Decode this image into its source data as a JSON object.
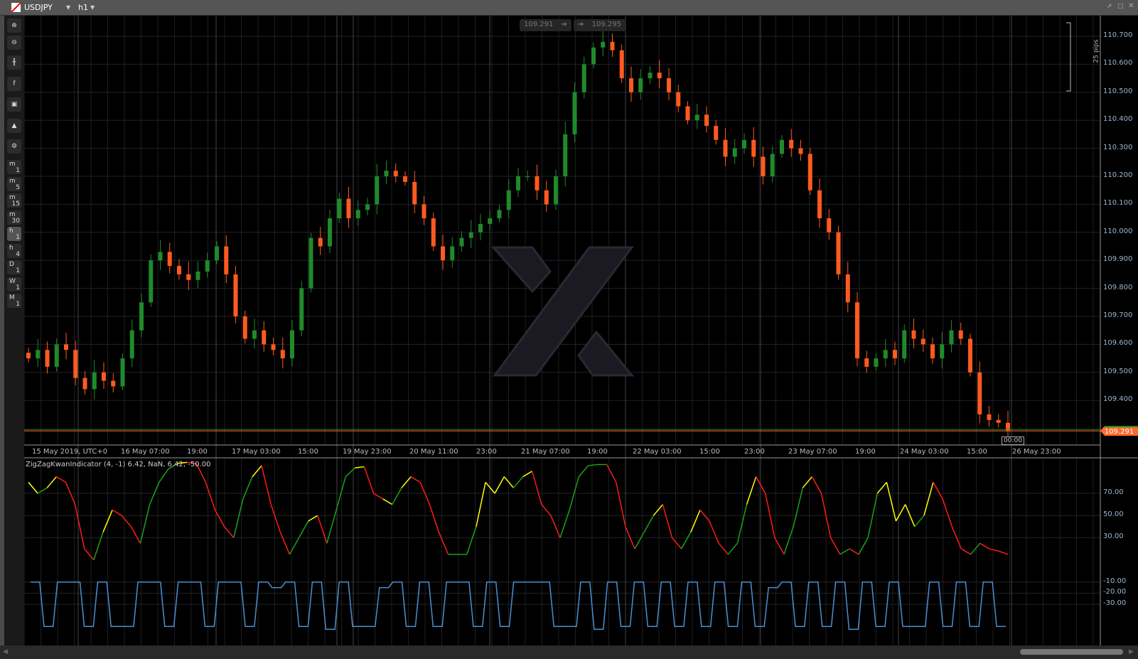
{
  "window": {
    "symbol": "USDJPY",
    "timeframe": "h1"
  },
  "toolbar": {
    "timeframes": [
      [
        "m",
        "1"
      ],
      [
        "m",
        "5"
      ],
      [
        "m",
        "15"
      ],
      [
        "m",
        "30"
      ],
      [
        "h",
        "1"
      ],
      [
        "h",
        "4"
      ],
      [
        "D",
        "1"
      ],
      [
        "W",
        "1"
      ],
      [
        "M",
        "1"
      ]
    ],
    "active": "h1"
  },
  "quick_trade": {
    "sell": "109.291",
    "buy": "109.295"
  },
  "price_axis": [
    "110.700",
    "110.600",
    "110.500",
    "110.400",
    "110.300",
    "110.200",
    "110.100",
    "110.000",
    "109.900",
    "109.800",
    "109.700",
    "109.600",
    "109.500",
    "109.400"
  ],
  "pips_ruler": "25 pips",
  "current_price": "109.291",
  "countdown": "00:00",
  "time_axis": [
    "15 May 2019, UTC+0",
    "16 May 07:00",
    "19:00",
    "17 May 03:00",
    "15:00",
    "19 May 23:00",
    "20 May 11:00",
    "23:00",
    "21 May 07:00",
    "19:00",
    "22 May 03:00",
    "15:00",
    "23:00",
    "23 May 07:00",
    "19:00",
    "24 May 03:00",
    "15:00",
    "26 May 23:00"
  ],
  "indicator": {
    "label": "ZigZagKwanIndicator (4, -1) 6.42, NaN, 6.42, -50.00",
    "axis": [
      "70.00",
      "50.00",
      "30.00",
      "-10.00",
      "-20.00",
      "-30.00"
    ]
  },
  "colors": {
    "bull": "#1f8a2a",
    "bear": "#ff5a1f",
    "up": "#1aa31a",
    "down": "#ff1a1a",
    "turn": "#ffff00",
    "signal": "#4a8fd0",
    "price_line": "#ff6a2a"
  },
  "chart_data": {
    "type": "candlestick",
    "wick": 0.03,
    "closes": [
      109.55,
      109.58,
      109.52,
      109.6,
      109.58,
      109.48,
      109.44,
      109.5,
      109.47,
      109.45,
      109.55,
      109.65,
      109.75,
      109.9,
      109.93,
      109.88,
      109.85,
      109.83,
      109.86,
      109.9,
      109.95,
      109.85,
      109.7,
      109.62,
      109.65,
      109.6,
      109.58,
      109.55,
      109.65,
      109.8,
      109.98,
      109.95,
      110.05,
      110.12,
      110.05,
      110.08,
      110.1,
      110.2,
      110.22,
      110.2,
      110.18,
      110.1,
      110.05,
      109.95,
      109.9,
      109.95,
      109.98,
      110.0,
      110.03,
      110.05,
      110.08,
      110.15,
      110.2,
      110.2,
      110.15,
      110.1,
      110.2,
      110.35,
      110.5,
      110.6,
      110.66,
      110.68,
      110.65,
      110.55,
      110.5,
      110.55,
      110.57,
      110.55,
      110.5,
      110.45,
      110.4,
      110.42,
      110.38,
      110.33,
      110.27,
      110.3,
      110.33,
      110.27,
      110.2,
      110.28,
      110.33,
      110.3,
      110.28,
      110.15,
      110.05,
      110.0,
      109.85,
      109.75,
      109.55,
      109.52,
      109.55,
      109.58,
      109.55,
      109.65,
      109.62,
      109.6,
      109.55,
      109.6,
      109.65,
      109.62,
      109.5,
      109.35,
      109.33,
      109.32,
      109.29
    ],
    "oscillator": [
      80,
      70,
      75,
      85,
      80,
      60,
      20,
      10,
      35,
      55,
      50,
      40,
      25,
      60,
      80,
      92,
      97,
      98,
      97,
      80,
      55,
      40,
      30,
      65,
      85,
      95,
      60,
      35,
      15,
      30,
      45,
      50,
      25,
      55,
      85,
      93,
      94,
      70,
      65,
      60,
      75,
      85,
      80,
      60,
      35,
      15,
      15,
      15,
      40,
      80,
      70,
      85,
      75,
      85,
      90,
      60,
      50,
      30,
      55,
      85,
      95,
      96,
      96,
      80,
      40,
      20,
      35,
      50,
      60,
      30,
      20,
      35,
      55,
      45,
      25,
      15,
      25,
      60,
      85,
      70,
      30,
      15,
      40,
      75,
      85,
      70,
      30,
      15,
      20,
      15,
      30,
      70,
      80,
      45,
      60,
      40,
      50,
      80,
      65,
      40,
      20,
      15,
      25,
      20,
      18,
      15
    ],
    "signal": [
      -10,
      -50,
      -10,
      -10,
      -50,
      -10,
      -50,
      -50,
      -10,
      -10,
      -50,
      -10,
      -10,
      -50,
      -10,
      -10,
      -50,
      -10,
      -15,
      -10,
      -50,
      -10,
      -60,
      -10,
      -50,
      -50,
      -15,
      -10,
      -50,
      -10,
      -50,
      -10,
      -10,
      -50,
      -10,
      -50,
      -10,
      -10,
      -10,
      -50,
      -50,
      -10,
      -60,
      -10,
      -50,
      -10,
      -50,
      -10,
      -50,
      -10,
      -50,
      -10,
      -50,
      -10,
      -50,
      -15,
      -10,
      -50,
      -10,
      -50,
      -10,
      -55,
      -10,
      -50,
      -10,
      -50,
      -50,
      -10,
      -50,
      -10,
      -50,
      -10,
      -50
    ],
    "price_range": [
      109.25,
      110.72
    ],
    "osc_range": [
      -60,
      100
    ]
  }
}
